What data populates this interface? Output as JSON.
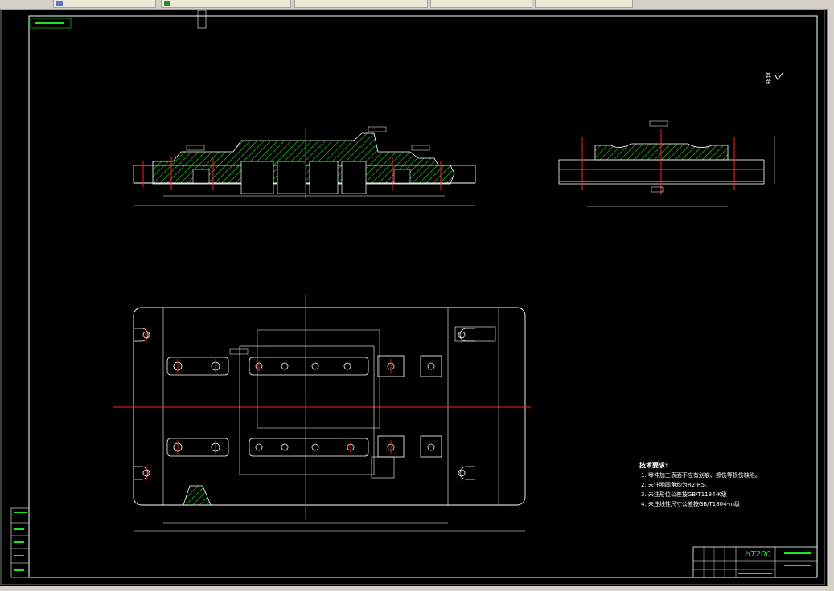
{
  "tabs": [
    {
      "label": ""
    },
    {
      "label": ""
    },
    {
      "label": ""
    },
    {
      "label": ""
    },
    {
      "label": ""
    }
  ],
  "drawing": {
    "tech_notes": {
      "title": "技术要求:",
      "lines": [
        "1. 零件加工表面不应有划痕、擦伤等损伤缺陷。",
        "2. 未注明圆角均为R2-R5。",
        "3. 未注形位公差按GB/T1184-K级",
        "4. 未注线性尺寸公差按GB/T1804-m级"
      ]
    },
    "roughness_label": "其余",
    "title_block": {
      "material": "HT200"
    },
    "colors": {
      "frame": "#ffffff",
      "part": "#ffffff",
      "center_line": "#ff2020",
      "hatch": "#1ee61e",
      "dimension": "#ffffff",
      "title_block_text": "#1ee61e"
    }
  }
}
